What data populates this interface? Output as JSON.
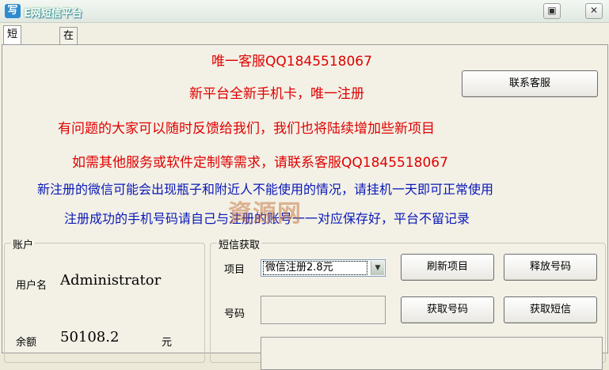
{
  "window": {
    "title": "E网短信平台",
    "min_label": "▣",
    "close_label": "✕"
  },
  "tabs": [
    {
      "label": "短信获取"
    },
    {
      "label": "在线充值"
    }
  ],
  "notices": {
    "line1": "唯一客服QQ1845518067",
    "line2": "新平台全新手机卡，唯一注册",
    "line3": "有问题的大家可以随时反馈给我们，我们也将陆续增加些新项目",
    "line4": "如需其他服务或软件定制等需求，请联系客服QQ1845518067",
    "line5": "新注册的微信可能会出现瓶子和附近人不能使用的情况，请挂机一天即可正常使用",
    "line6": "注册成功的手机号码请自己与注册的账号一一对应保存好，平台不留记录"
  },
  "buttons": {
    "contact": "联系客服",
    "refresh_project": "刷新项目",
    "release_number": "释放号码",
    "get_number": "获取号码",
    "get_sms": "获取短信"
  },
  "account": {
    "group_label": "账户",
    "username_label": "用户名",
    "username_value": "Administrator",
    "balance_label": "余额",
    "balance_value": "50108.2",
    "balance_unit": "元"
  },
  "sms": {
    "group_label": "短信获取",
    "project_label": "项目",
    "project_selected": "微信注册2.8元",
    "number_label": "号码",
    "number_value": ""
  },
  "watermark": "資源网",
  "colors": {
    "notice_red": "#e00000",
    "notice_blue": "#0a18b8"
  }
}
